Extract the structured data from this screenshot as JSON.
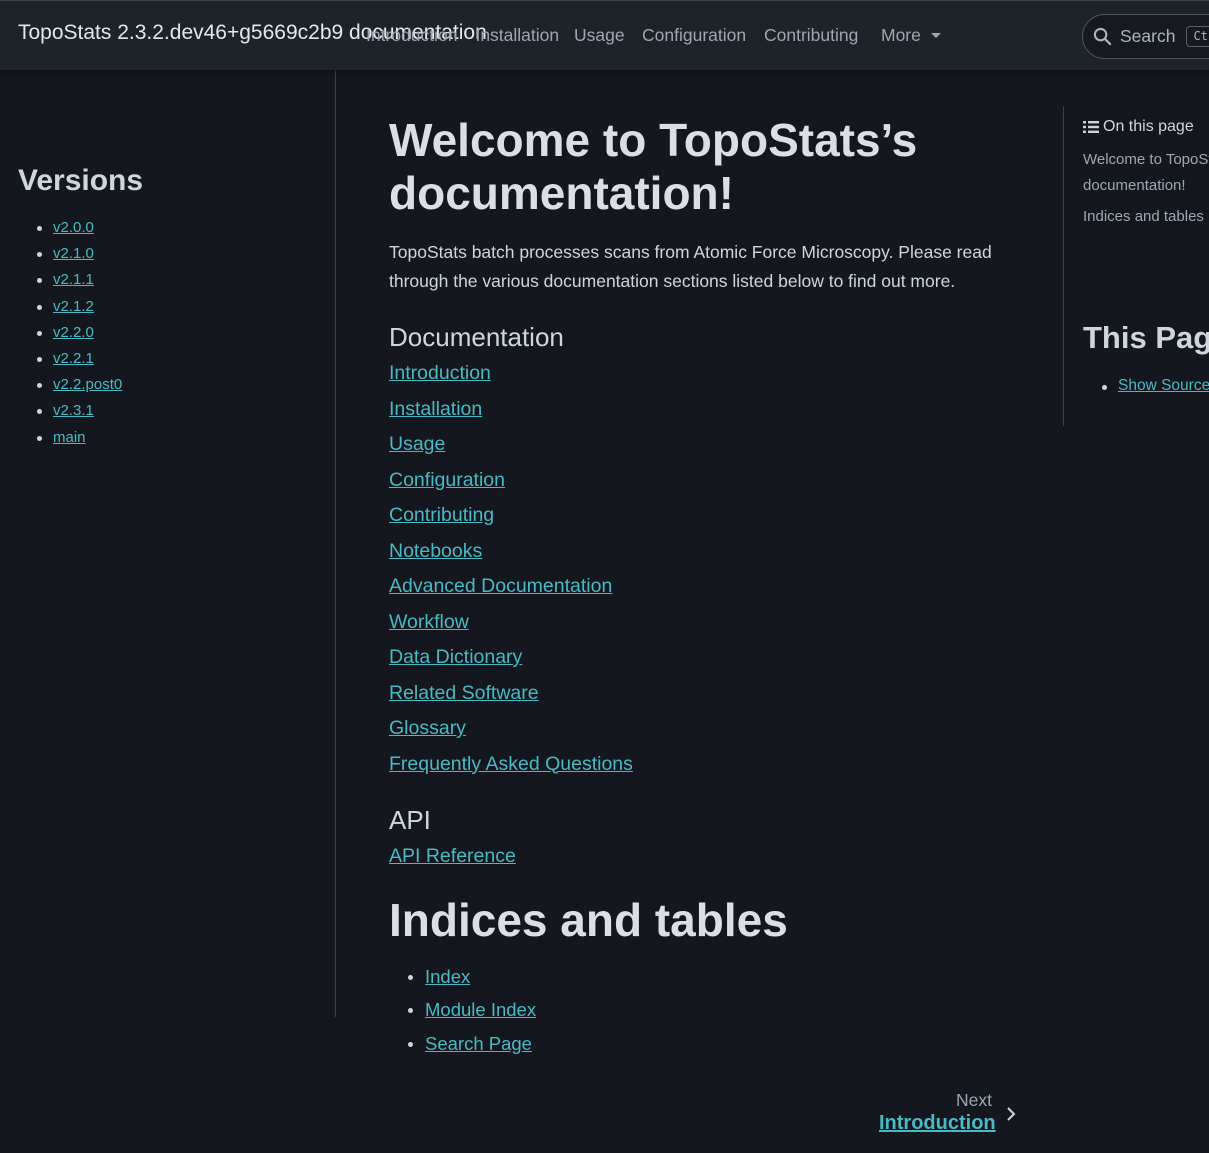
{
  "header": {
    "brand": "TopoStats 2.3.2.dev46+g5669c2b9 documentation",
    "nav_items": [
      "Introduction",
      "Installation",
      "Usage",
      "Configuration",
      "Contributing"
    ],
    "more_label": "More",
    "search_label": "Search",
    "search_shortcut": "Ct",
    "icons": {
      "search": "magnifier-icon",
      "more": "caret-down-icon"
    }
  },
  "sidebar": {
    "heading": "Versions",
    "versions": [
      "v2.0.0",
      "v2.1.0",
      "v2.1.1",
      "v2.1.2",
      "v2.2.0",
      "v2.2.1",
      "v2.2.post0",
      "v2.3.1",
      "main"
    ]
  },
  "main": {
    "title": "Welcome to TopoStats’s documentation!",
    "intro": "TopoStats batch processes scans from Atomic Force Microscopy. Please read through the various documentation sections listed below to find out more.",
    "documentation_heading": "Documentation",
    "documentation_links": [
      "Introduction",
      "Installation",
      "Usage",
      "Configuration",
      "Contributing",
      "Notebooks",
      "Advanced Documentation",
      "Workflow",
      "Data Dictionary",
      "Related Software",
      "Glossary",
      "Frequently Asked Questions"
    ],
    "api_heading": "API",
    "api_links": [
      "API Reference"
    ],
    "indices_heading": "Indices and tables",
    "indices_links": [
      "Index",
      "Module Index",
      "Search Page"
    ]
  },
  "pager": {
    "next_label": "Next",
    "next_title": "Introduction"
  },
  "toc": {
    "title": "On this page",
    "items": [
      "Welcome to TopoStats’s documentation!",
      "Indices and tables"
    ],
    "this_page_heading": "This Page",
    "this_page_links": [
      "Show Source"
    ]
  },
  "colors": {
    "background": "#14181e",
    "header": "#1d2329",
    "link": "#48b9c5",
    "text": "#ced6dd"
  }
}
